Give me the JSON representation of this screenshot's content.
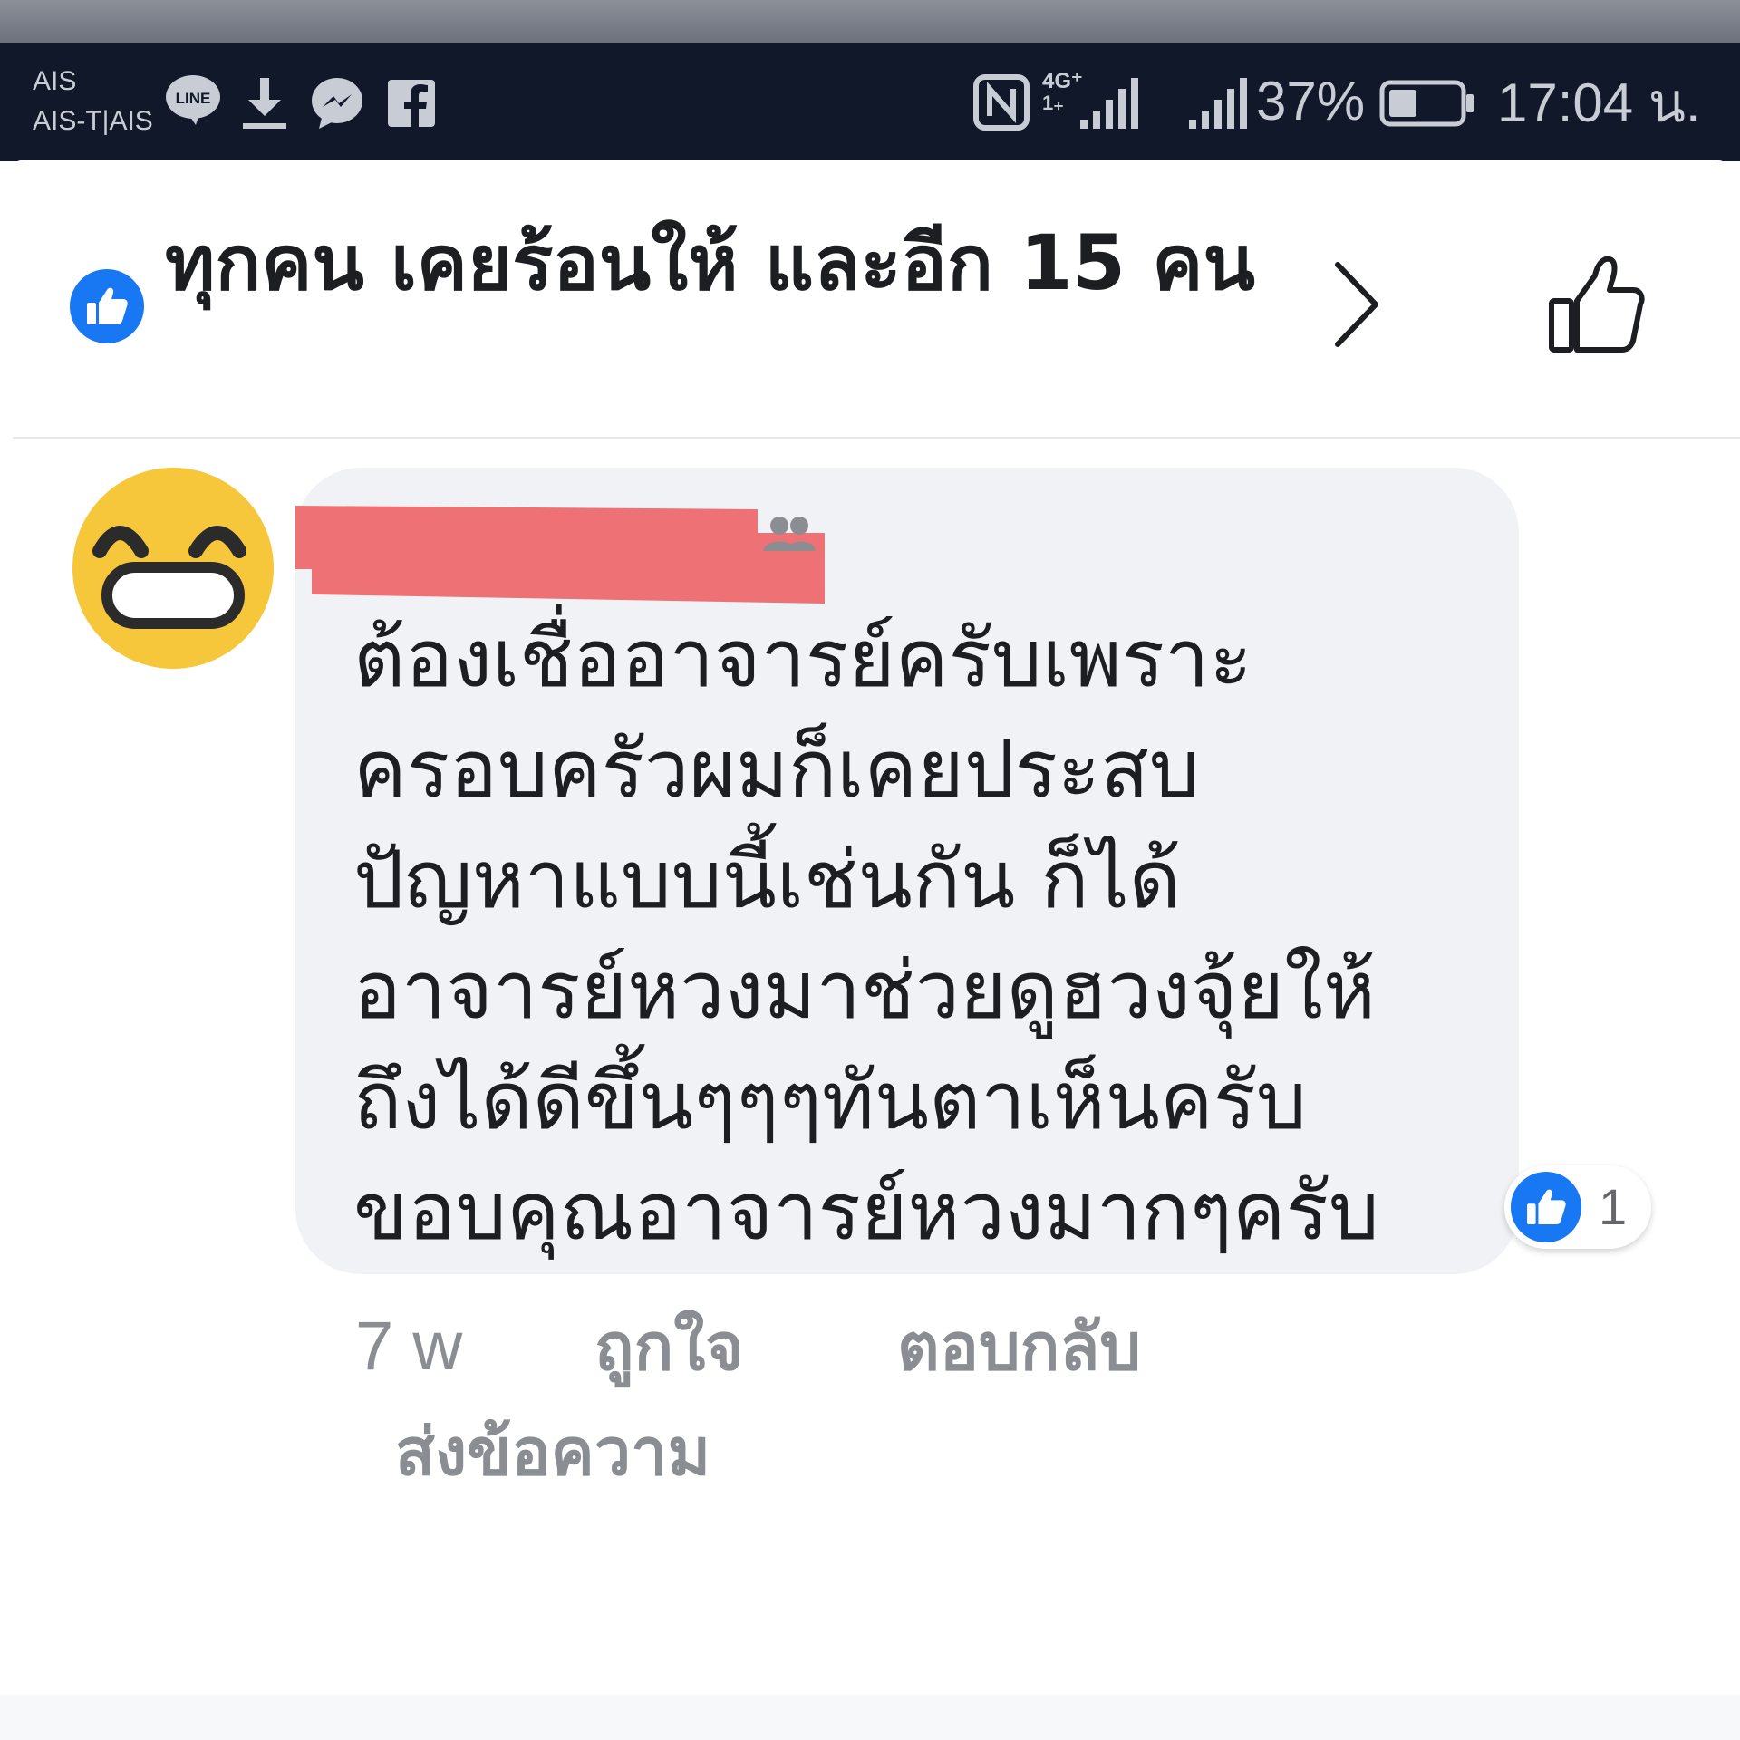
{
  "status_bar": {
    "carrier_line1": "AIS",
    "carrier_line2": "AIS-T|AIS",
    "line_icon_label": "LINE",
    "network": "4G⁺",
    "network_sub": "1₊",
    "battery_percent": "37%",
    "time": "17:04 น.",
    "icons": [
      "line-icon",
      "download-icon",
      "messenger-icon",
      "facebook-icon",
      "nfc-icon",
      "signal-icon",
      "battery-icon"
    ]
  },
  "reactions_header": {
    "title": "ทุกคน เคยร้อนให้ และอีก 15 คน",
    "reaction_icon": "like-icon"
  },
  "comment": {
    "text": "ต้องเชื่ออาจารย์ครับเพราะ\nครอบครัวผมก็เคยประสบ\nปัญหาแบบนี้เช่นกัน ก็ได้\nอาจารย์หวงมาช่วยดูฮวงจุ้ยให้\nถึงได้ดีขึ้นๆๆๆทันตาเห็นครับ\nขอบคุณอาจารย์หวงมากๆครับ",
    "like_count": "1",
    "time": "7 w",
    "like_action": "ถูกใจ",
    "reply_action": "ตอบกลับ",
    "message_action": "ส่งข้อความ"
  },
  "colors": {
    "facebook_blue": "#1877f2",
    "bubble_bg": "#f0f2f5",
    "redaction": "#ee7275",
    "emoji_yellow": "#f7c73b"
  }
}
